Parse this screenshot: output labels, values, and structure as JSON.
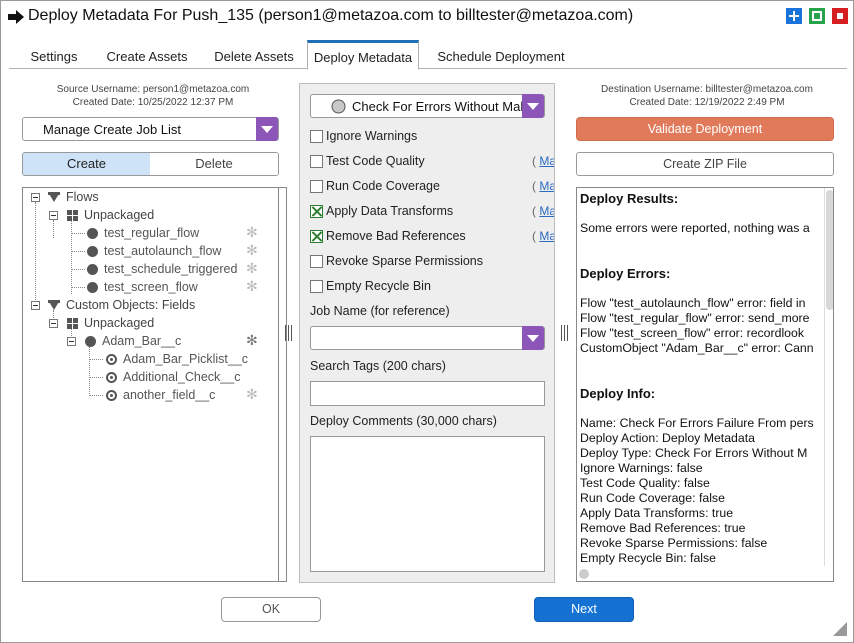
{
  "window": {
    "title": "Deploy Metadata For Push_135 (person1@metazoa.com to billtester@metazoa.com)",
    "arrow_icon": "arrow-right-icon",
    "controls": {
      "minimize_icon": "plus-icon",
      "maximize_icon": "square-icon",
      "close_icon": "stop-icon"
    },
    "colors": {
      "minimize": "#1a73d9",
      "maximize": "#27a34a",
      "close": "#d42020"
    }
  },
  "tabs": [
    {
      "label": "Settings"
    },
    {
      "label": "Create Assets"
    },
    {
      "label": "Delete Assets"
    },
    {
      "label": "Deploy Metadata",
      "active": true
    },
    {
      "label": "Schedule Deployment"
    }
  ],
  "source": {
    "username": "Source Username: person1@metazoa.com",
    "created": "Created Date: 10/25/2022 12:37 PM",
    "job_list": "Manage Create Job List",
    "mode_create": "Create",
    "mode_delete": "Delete",
    "tree": {
      "flows": "Flows",
      "flows_unpackaged": "Unpackaged",
      "flow_items": [
        "test_regular_flow",
        "test_autolaunch_flow",
        "test_schedule_triggered",
        "test_screen_flow"
      ],
      "fields": "Custom Objects: Fields",
      "fields_unpackaged": "Unpackaged",
      "object": "Adam_Bar__c",
      "field_items": [
        "Adam_Bar_Picklist__c",
        "Additional_Check__c",
        "another_field__c"
      ]
    }
  },
  "options": {
    "deploy_type": "Check For Errors Without Making Changes",
    "checkboxes": [
      {
        "label": "Ignore Warnings",
        "checked": false,
        "manage": false
      },
      {
        "label": "Test Code Quality",
        "checked": false,
        "manage": true
      },
      {
        "label": "Run Code Coverage",
        "checked": false,
        "manage": true
      },
      {
        "label": "Apply Data Transforms",
        "checked": true,
        "manage": true
      },
      {
        "label": "Remove Bad References",
        "checked": true,
        "manage": true
      },
      {
        "label": "Revoke Sparse Permissions",
        "checked": false,
        "manage": false
      },
      {
        "label": "Empty Recycle Bin",
        "checked": false,
        "manage": false
      }
    ],
    "manage_paren": "(",
    "manage_link": "Ma",
    "job_name_label": "Job Name (for reference)",
    "job_name_value": "",
    "search_tags_label": "Search Tags (200 chars)",
    "search_tags_value": "",
    "comments_label": "Deploy Comments (30,000 chars)",
    "comments_value": ""
  },
  "destination": {
    "username": "Destination Username: billtester@metazoa.com",
    "created": "Created Date: 12/19/2022 2:49 PM",
    "validate": "Validate Deployment",
    "zip": "Create ZIP File",
    "results": {
      "results_head": "Deploy Results:",
      "results_text": "Some errors were reported, nothing was a",
      "errors_head": "Deploy Errors:",
      "errors": [
        "Flow \"test_autolaunch_flow\" error: field in",
        "Flow \"test_regular_flow\" error: send_more",
        "Flow \"test_screen_flow\" error: recordlook",
        "CustomObject \"Adam_Bar__c\" error: Cann"
      ],
      "info_head": "Deploy Info:",
      "info": [
        "Name: Check For Errors Failure From pers",
        "Deploy Action: Deploy Metadata",
        "Deploy Type: Check For Errors Without M",
        "Ignore Warnings: false",
        "Test Code Quality: false",
        "Run Code Coverage: false",
        "Apply Data Transforms: true",
        "Remove Bad References: true",
        "Revoke Sparse Permissions: false",
        "Empty Recycle Bin: false"
      ]
    }
  },
  "footer": {
    "ok": "OK",
    "next": "Next"
  },
  "colors": {
    "accent": "#1572d3",
    "validate": "#e07a5a",
    "dropdown": "#8b56b8",
    "segment_on": "#cfe3f8"
  }
}
